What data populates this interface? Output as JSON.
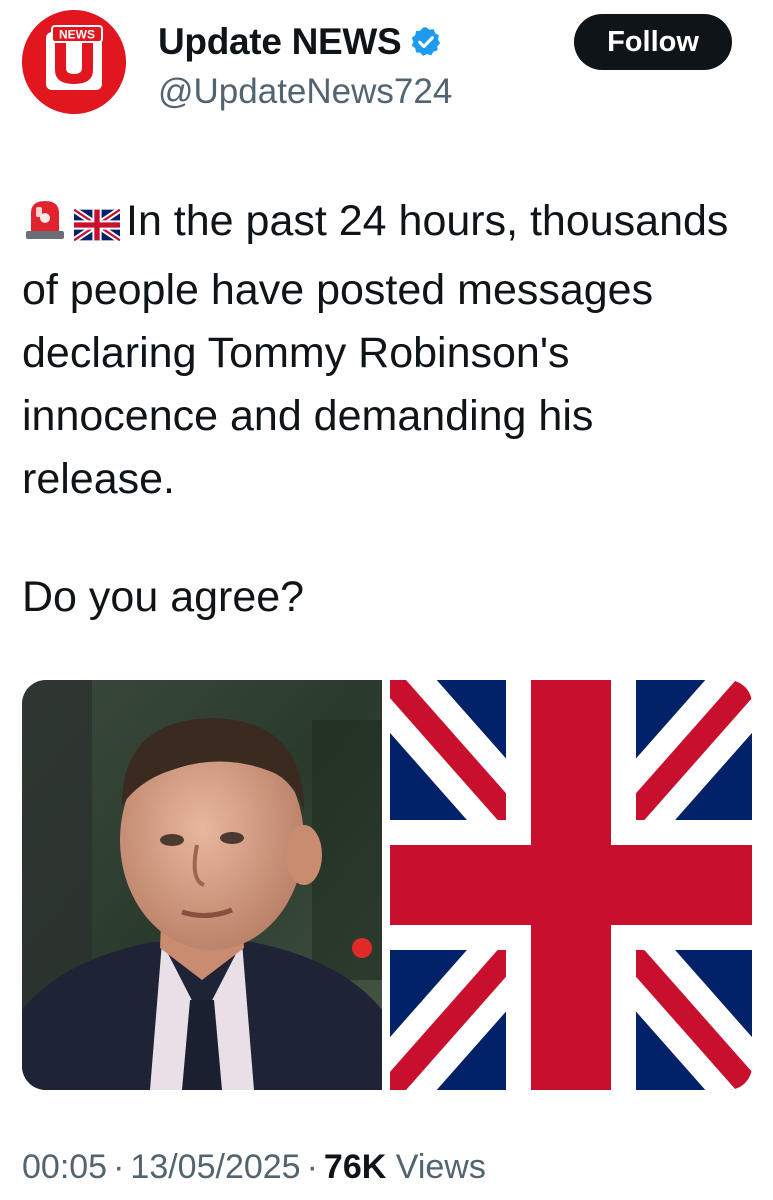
{
  "account": {
    "display_name": "Update NEWS",
    "handle": "@UpdateNews724",
    "verified": true,
    "avatar_badge_text": "NEWS",
    "avatar_letter": "U",
    "brand_color": "#e1161e"
  },
  "follow_label": "Follow",
  "tweet": {
    "emojis": [
      "rotating-light-icon",
      "uk-flag-icon"
    ],
    "text": "In the past 24 hours, thousands of people have posted messages declaring Tommy Robinson's innocence and demanding his release.",
    "question": "Do you agree?"
  },
  "media": [
    {
      "type": "photo",
      "description_icon": "man-portrait-image"
    },
    {
      "type": "photo",
      "description_icon": "union-jack-flag-image"
    }
  ],
  "meta": {
    "time": "00:05",
    "date": "13/05/2025",
    "views_count": "76K",
    "views_label": "Views",
    "separator": "·"
  },
  "colors": {
    "text": "#0f1419",
    "secondary": "#536471",
    "verified_blue": "#1d9bf0",
    "flag_red": "#c8102e",
    "flag_blue": "#012169"
  }
}
